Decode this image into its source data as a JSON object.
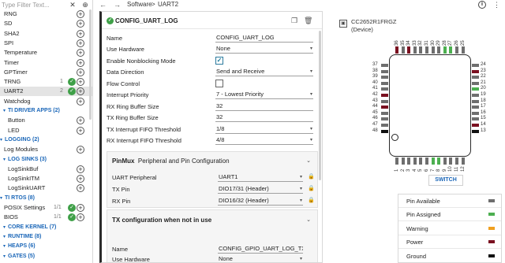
{
  "sidebar": {
    "filter_placeholder": "Type Filter Text...",
    "rows": [
      {
        "type": "item",
        "label": "RNG",
        "add": true
      },
      {
        "type": "item",
        "label": "SD",
        "add": true
      },
      {
        "type": "item",
        "label": "SHA2",
        "add": true
      },
      {
        "type": "item",
        "label": "SPI",
        "add": true
      },
      {
        "type": "item",
        "label": "Temperature",
        "add": true
      },
      {
        "type": "item",
        "label": "Timer",
        "add": true
      },
      {
        "type": "item",
        "label": "GPTimer",
        "add": true
      },
      {
        "type": "item",
        "label": "TRNG",
        "count": "1",
        "check": true,
        "add": true
      },
      {
        "type": "item",
        "label": "UART2",
        "count": "2",
        "check": true,
        "add": true,
        "selected": true
      },
      {
        "type": "item",
        "label": "Watchdog",
        "add": true
      },
      {
        "type": "category",
        "label": "TI DRIVER APPS (2)",
        "level": 1
      },
      {
        "type": "item",
        "label": "Button",
        "indent": 2,
        "add": true
      },
      {
        "type": "item",
        "label": "LED",
        "indent": 2,
        "add": true
      },
      {
        "type": "category",
        "label": "LOGGING (2)",
        "level": 0
      },
      {
        "type": "item",
        "label": "Log Modules",
        "indent": 1,
        "add": true
      },
      {
        "type": "category",
        "label": "LOG SINKS (3)",
        "level": 1
      },
      {
        "type": "item",
        "label": "LogSinkBuf",
        "indent": 2,
        "add": true
      },
      {
        "type": "item",
        "label": "LogSinkITM",
        "indent": 2,
        "add": true
      },
      {
        "type": "item",
        "label": "LogSinkUART",
        "indent": 2,
        "add": true
      },
      {
        "type": "category",
        "label": "TI RTOS (8)",
        "level": 0
      },
      {
        "type": "item",
        "label": "POSIX Settings",
        "count": "1/1",
        "check": true,
        "add": true,
        "indent": 1
      },
      {
        "type": "item",
        "label": "BIOS",
        "count": "1/1",
        "check": true,
        "add": true,
        "indent": 1
      },
      {
        "type": "category",
        "label": "CORE KERNEL (7)",
        "level": 1
      },
      {
        "type": "category",
        "label": "RUNTIME (8)",
        "level": 1
      },
      {
        "type": "category",
        "label": "HEAPS (6)",
        "level": 1
      },
      {
        "type": "category",
        "label": "GATES (5)",
        "level": 1
      }
    ]
  },
  "toolbar": {
    "crumbs": [
      "Software",
      "UART2"
    ]
  },
  "config": {
    "title": "CONFIG_UART_LOG",
    "fields": [
      {
        "label": "Name",
        "value": "CONFIG_UART_LOG",
        "kind": "text"
      },
      {
        "label": "Use Hardware",
        "value": "None",
        "kind": "select"
      },
      {
        "label": "Enable Nonblocking Mode",
        "value": "",
        "kind": "check-on"
      },
      {
        "label": "Data Direction",
        "value": "Send and Receive",
        "kind": "select"
      },
      {
        "label": "Flow Control",
        "value": "",
        "kind": "check-off"
      },
      {
        "label": "Interrupt Priority",
        "value": "7 - Lowest Priority",
        "kind": "select"
      },
      {
        "label": "RX Ring Buffer Size",
        "value": "32",
        "kind": "text"
      },
      {
        "label": "TX Ring Buffer Size",
        "value": "32",
        "kind": "text"
      },
      {
        "label": "TX Interrupt FIFO Threshold",
        "value": "1/8",
        "kind": "select"
      },
      {
        "label": "RX Interrupt FIFO Threshold",
        "value": "4/8",
        "kind": "select"
      }
    ],
    "pinmux": {
      "prefix": "PinMux",
      "title": "Peripheral and Pin Configuration",
      "fields": [
        {
          "label": "UART Peripheral",
          "value": "UART1"
        },
        {
          "label": "TX Pin",
          "value": "DIO17/31 (Header)"
        },
        {
          "label": "RX Pin",
          "value": "DIO16/32 (Header)"
        }
      ]
    },
    "tx_section": {
      "title": "TX configuration when not in use",
      "fields": [
        {
          "label": "Name",
          "value": "CONFIG_GPIO_UART_LOG_TX",
          "kind": "text"
        },
        {
          "label": "Use Hardware",
          "value": "None",
          "kind": "select"
        }
      ]
    }
  },
  "device": {
    "name": "CC2652R1FRGZ",
    "sub": "(Device)",
    "switch_label": "SWITCH",
    "colors": {
      "available": "#6e6e6e",
      "assigned": "#4caf50",
      "warning": "#f0a020",
      "power": "#7a1020",
      "ground": "#111111"
    },
    "pins": {
      "left_labels": [
        "37",
        "38",
        "39",
        "40",
        "41",
        "42",
        "43",
        "44",
        "45",
        "46",
        "47",
        "48"
      ],
      "left_colors": [
        "available",
        "available",
        "available",
        "available",
        "available",
        "power",
        "available",
        "power",
        "available",
        "available",
        "available",
        "ground"
      ],
      "right_labels": [
        "24",
        "23",
        "22",
        "21",
        "20",
        "19",
        "18",
        "17",
        "16",
        "15",
        "14",
        "13"
      ],
      "right_colors": [
        "available",
        "power",
        "available",
        "available",
        "assigned",
        "available",
        "available",
        "available",
        "available",
        "available",
        "power",
        "ground"
      ],
      "top_labels": [
        "36",
        "35",
        "34",
        "33",
        "32",
        "31",
        "30",
        "29",
        "28",
        "27",
        "26",
        "25"
      ],
      "top_colors": [
        "power",
        "available",
        "power",
        "available",
        "available",
        "available",
        "available",
        "available",
        "assigned",
        "assigned",
        "available",
        "available"
      ],
      "bottom_labels": [
        "1",
        "2",
        "3",
        "4",
        "5",
        "6",
        "7",
        "8",
        "9",
        "10",
        "11",
        "12"
      ],
      "bottom_colors": [
        "available",
        "available",
        "available",
        "available",
        "available",
        "available",
        "assigned",
        "assigned",
        "available",
        "available",
        "available",
        "available"
      ]
    },
    "legend": [
      {
        "label": "Pin Available",
        "color": "available"
      },
      {
        "label": "Pin Assigned",
        "color": "assigned"
      },
      {
        "label": "Warning",
        "color": "warning"
      },
      {
        "label": "Power",
        "color": "power"
      },
      {
        "label": "Ground",
        "color": "ground"
      }
    ]
  }
}
